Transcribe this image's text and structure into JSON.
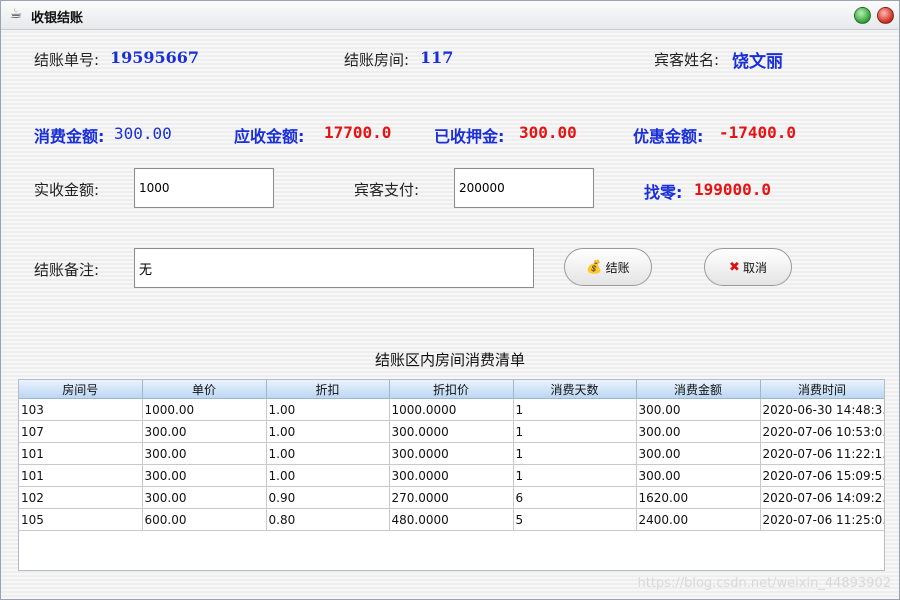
{
  "window": {
    "title": "收银结账",
    "app_icon": "java-cup-icon"
  },
  "header": {
    "bill_no_label": "结账单号:",
    "bill_no": "19595667",
    "room_label": "结账房间:",
    "room": "117",
    "guest_label": "宾客姓名:",
    "guest": "饶文丽"
  },
  "amounts": {
    "consume_label": "消费金额:",
    "consume": "300.00",
    "receivable_label": "应收金额:",
    "receivable": "17700.0",
    "deposit_label": "已收押金:",
    "deposit": "300.00",
    "discount_label": "优惠金额:",
    "discount": "-17400.0"
  },
  "payment": {
    "actual_label": "实收金额:",
    "actual_value": "1000",
    "guest_pay_label": "宾客支付:",
    "guest_pay_value": "200000",
    "change_label": "找零:",
    "change": "199000.0"
  },
  "remark": {
    "label": "结账备注:",
    "value": "无"
  },
  "buttons": {
    "settle_label": "结账",
    "cancel_label": "取消"
  },
  "list": {
    "title": "结账区内房间消费清单",
    "columns": [
      "房间号",
      "单价",
      "折扣",
      "折扣价",
      "消费天数",
      "消费金额",
      "消费时间"
    ],
    "rows": [
      [
        "103",
        "1000.00",
        "1.00",
        "1000.0000",
        "1",
        "300.00",
        "2020-06-30 14:48:3..."
      ],
      [
        "107",
        "300.00",
        "1.00",
        "300.0000",
        "1",
        "300.00",
        "2020-07-06 10:53:0..."
      ],
      [
        "101",
        "300.00",
        "1.00",
        "300.0000",
        "1",
        "300.00",
        "2020-07-06 11:22:1..."
      ],
      [
        "101",
        "300.00",
        "1.00",
        "300.0000",
        "1",
        "300.00",
        "2020-07-06 15:09:5..."
      ],
      [
        "102",
        "300.00",
        "0.90",
        "270.0000",
        "6",
        "1620.00",
        "2020-07-06 14:09:2..."
      ],
      [
        "105",
        "600.00",
        "0.80",
        "480.0000",
        "5",
        "2400.00",
        "2020-07-06 11:25:0..."
      ]
    ]
  },
  "watermark": "https://blog.csdn.net/weixin_44893902",
  "colors": {
    "label_blue": "#1a2fd6",
    "value_red": "#e51313",
    "header_blue": "#bcd7f2"
  }
}
